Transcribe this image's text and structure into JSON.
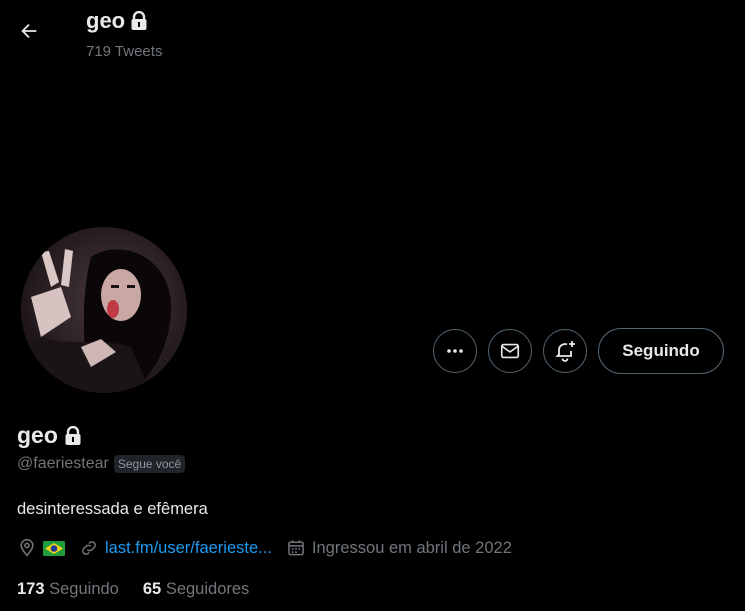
{
  "header": {
    "display_name": "geo",
    "tweet_count": "719 Tweets"
  },
  "profile": {
    "display_name": "geo",
    "handle": "@faeriestear",
    "follows_you_badge": "Segue você",
    "bio": "desinteressada e efêmera",
    "location_flag": "🇧🇷",
    "link_text": "last.fm/user/faerieste...",
    "joined": "Ingressou em abril de 2022",
    "following_count": "173",
    "following_label": "Seguindo",
    "followers_count": "65",
    "followers_label": "Seguidores"
  },
  "actions": {
    "more_icon": "more-icon",
    "message_icon": "mail-icon",
    "notify_icon": "bell-plus-icon",
    "follow_label": "Seguindo"
  },
  "colors": {
    "background": "#000000",
    "text_primary": "#e7e9ea",
    "text_secondary": "#71767b",
    "link": "#1d9bf0",
    "border": "#536471"
  }
}
